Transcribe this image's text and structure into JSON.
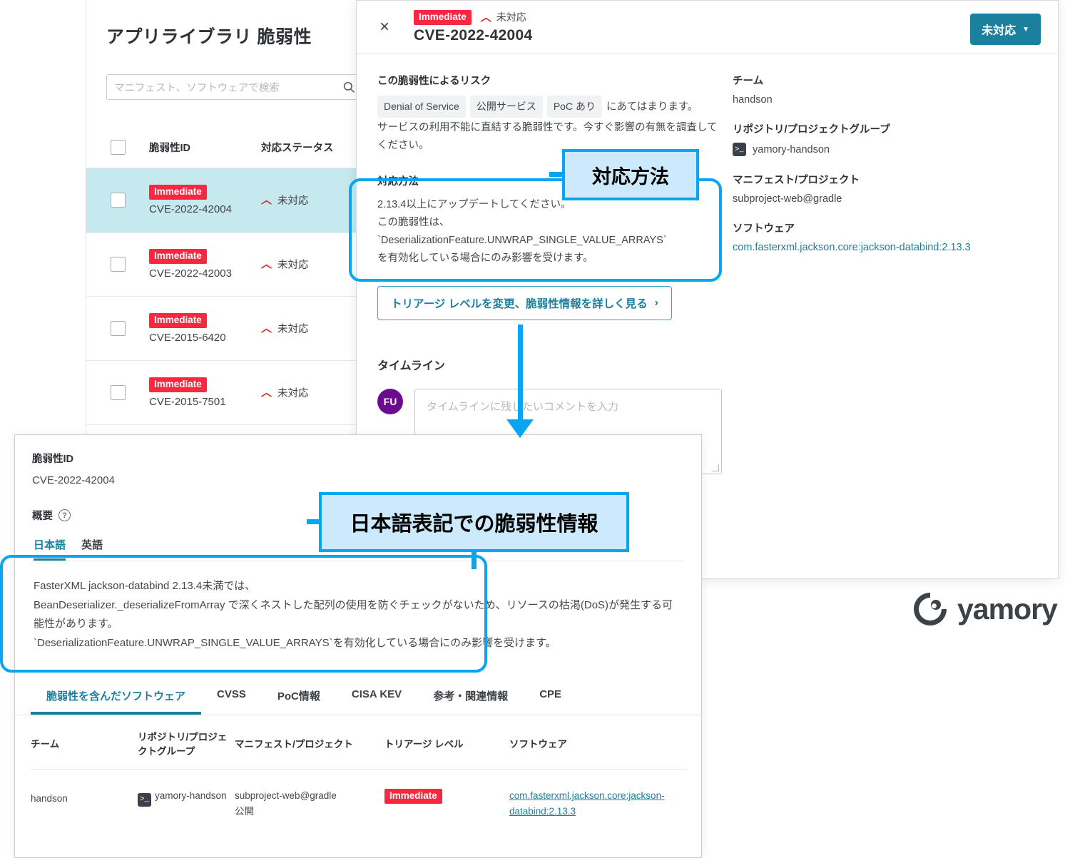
{
  "list_panel": {
    "title": "アプリライブラリ 脆弱性",
    "search": {
      "placeholder": "マニフェスト、ソフトウェアで検索",
      "icon": "search-icon"
    },
    "columns": {
      "id": "脆弱性ID",
      "status": "対応ステータス"
    },
    "rows": [
      {
        "level": "Immediate",
        "cve": "CVE-2022-42004",
        "status": "未対応",
        "selected": true
      },
      {
        "level": "Immediate",
        "cve": "CVE-2022-42003",
        "status": "未対応",
        "selected": false
      },
      {
        "level": "Immediate",
        "cve": "CVE-2015-6420",
        "status": "未対応",
        "selected": false
      },
      {
        "level": "Immediate",
        "cve": "CVE-2015-7501",
        "status": "未対応",
        "selected": false
      }
    ]
  },
  "detail": {
    "close_icon": "×",
    "level_badge": "Immediate",
    "status_text": "未対応",
    "cve_id": "CVE-2022-42004",
    "status_button": "未対応",
    "status_button_caret": "▼",
    "risk_label": "この脆弱性によるリスク",
    "risk_chips": [
      "Denial of Service",
      "公開サービス",
      "PoC あり"
    ],
    "risk_suffix": "にあてはまります。",
    "risk_desc": "サービスの利用不能に直結する脆弱性です。今すぐ影響の有無を調査してください。",
    "remedy_label": "対応方法",
    "remedy_text": "2.13.4以上にアップデートしてください。\nこの脆弱性は、\n`DeserializationFeature.UNWRAP_SINGLE_VALUE_ARRAYS`\nを有効化している場合にのみ影響を受けます。",
    "triage_button": "トリアージ レベルを変更、脆弱性情報を詳しく見る",
    "triage_chevron": "›",
    "timeline_heading": "タイムライン",
    "avatar_initials": "FU",
    "comment_placeholder": "タイムラインに残したいコメントを入力",
    "fields": [
      {
        "label": "チーム",
        "value": "handson",
        "is_link": false,
        "icon": ""
      },
      {
        "label": "リポジトリ/プロジェクトグループ",
        "value": "yamory-handson",
        "is_link": false,
        "icon": "terminal-icon"
      },
      {
        "label": "マニフェスト/プロジェクト",
        "value": "subproject-web@gradle",
        "is_link": false,
        "icon": ""
      },
      {
        "label": "ソフトウェア",
        "value": "com.fasterxml.jackson.core:jackson-databind:2.13.3",
        "is_link": true,
        "icon": ""
      }
    ]
  },
  "vuln_card": {
    "id_label": "脆弱性ID",
    "id_value": "CVE-2022-42004",
    "summary_label": "概要",
    "help_icon": "?",
    "lang_tabs": [
      {
        "label": "日本語",
        "active": true
      },
      {
        "label": "英語",
        "active": false
      }
    ],
    "description": "FasterXML jackson-databind 2.13.4未満では、\nBeanDeserializer._deserializeFromArray で深くネストした配列の使用を防ぐチェックがないため、リソースの枯渇(DoS)が発生する可能性があります。\n`DeserializationFeature.UNWRAP_SINGLE_VALUE_ARRAYS`を有効化している場合にのみ影響を受けます。",
    "tabs": [
      {
        "label": "脆弱性を含んだソフトウェア",
        "active": true
      },
      {
        "label": "CVSS",
        "active": false
      },
      {
        "label": "PoC情報",
        "active": false
      },
      {
        "label": "CISA KEV",
        "active": false
      },
      {
        "label": "参考・関連情報",
        "active": false
      },
      {
        "label": "CPE",
        "active": false
      }
    ],
    "table": {
      "headers": [
        "チーム",
        "リポジトリ/プロジェクトグループ",
        "マニフェスト/プロジェクト",
        "トリアージ レベル",
        "ソフトウェア"
      ],
      "row": {
        "team": "handson",
        "repo": "yamory-handson",
        "repo_icon": "terminal-icon",
        "manifest": "subproject-web@gradle\n公開",
        "triage": "Immediate",
        "software": "com.fasterxml.jackson.core:jackson-databind:2.13.3"
      }
    }
  },
  "callouts": {
    "remedy": "対応方法",
    "japanese": "日本語表記での脆弱性情報"
  },
  "brand": {
    "name": "yamory"
  },
  "colors": {
    "accent": "#1b7f9e",
    "callout_border": "#08a5f0",
    "callout_fill": "#cdeafc",
    "badge_red": "#fa2741",
    "row_selected": "#c6e8ef",
    "avatar": "#6b0c8f"
  }
}
